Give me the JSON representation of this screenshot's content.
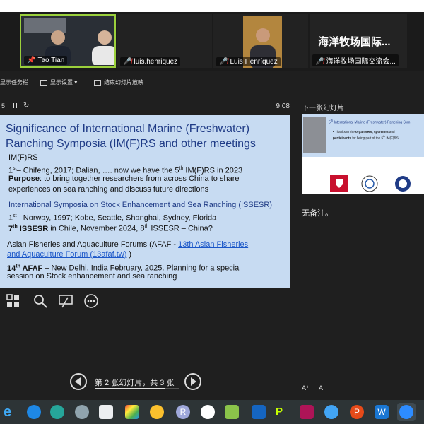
{
  "gallery": {
    "tiles": [
      {
        "name": "Tao Tian",
        "muted": false,
        "pinned": true
      },
      {
        "name": "luis.henriquez",
        "muted": true
      },
      {
        "name": "Luis Henríquez",
        "muted": true
      },
      {
        "name": "海洋牧场国际交流会...",
        "muted": true,
        "label_big": "海洋牧场国际..."
      }
    ]
  },
  "toolbar": {
    "show_taskbar": "显示任务栏",
    "display_settings": "显示设置 ▾",
    "end_slideshow": "结束幻灯片放映"
  },
  "presenter": {
    "slide_counter": "5",
    "timer": "9:08",
    "nav_text": "第 2 张幻灯片，共 3 张",
    "next_slide_label": "下一张幻灯片",
    "notes": "无备注。",
    "font_increase": "A⁺",
    "font_decrease": "A⁻"
  },
  "slide": {
    "title": "Significance of International Marine (Freshwater) Ranching Symposia (IM(F)RS and other meetings",
    "imfrs_heading": "IM(F)RS",
    "imfrs_line1_ord": "st",
    "imfrs_line1_pre": "1",
    "imfrs_line1_text": "– Chifeng, 2017; Dalian, …. now we have the 5",
    "imfrs_line1_ord2": "th",
    "imfrs_line1_end": " IM(F)RS in 2023",
    "purpose_label": "Purpose",
    "purpose_text": ": to bring together researchers from across China to share",
    "purpose_text2": "experiences on sea ranching and discuss future directions",
    "issesr_heading": "International Symposia on Stock Enhancement and Sea Ranching (ISSESR)",
    "issesr_line1_pre": "1",
    "issesr_line1_ord": "st",
    "issesr_line1_text": "– Norway, 1997; Kobe, Seattle, Shanghai, Sydney, Florida",
    "issesr_line2_pre": "7",
    "issesr_line2_ord": "th",
    "issesr_line2_bold": " ISSESR",
    "issesr_line2_text": " in Chile, November 2024, 8",
    "issesr_line2_ord2": "th",
    "issesr_line2_end": " ISSESR – China?",
    "afaf_heading": "Asian Fisheries and Aquaculture Forums (AFAF - ",
    "afaf_link1": "13th Asian Fisheries",
    "afaf_link2": "and Aquaculture Forum (13afaf.tw)",
    "afaf_close": " )",
    "afaf_line1_pre": "14",
    "afaf_line1_ord": "th",
    "afaf_line1_bold": " AFAF",
    "afaf_line1_text": " – New Delhi, India February, 2025. Planning for a special",
    "afaf_line2": "session on Stock enhancement and sea ranching"
  },
  "next_slide": {
    "title_pre": "5",
    "title_ord": "th",
    "title_text": " International Marine (Freshwater) Ranching Sym",
    "bullet_a": "Thanks to the ",
    "bullet_b": "organisers, sponsors",
    "bullet_c": " and",
    "bullet_d": "participants",
    "bullet_e": " for being part of the 5",
    "bullet_ord": "th",
    "bullet_f": " IM(F)RS"
  },
  "colors": {
    "slide_bg": "#c7dbf2",
    "title_blue": "#1f3b86",
    "link_blue": "#1a56c8",
    "mute_red": "#e53935"
  }
}
